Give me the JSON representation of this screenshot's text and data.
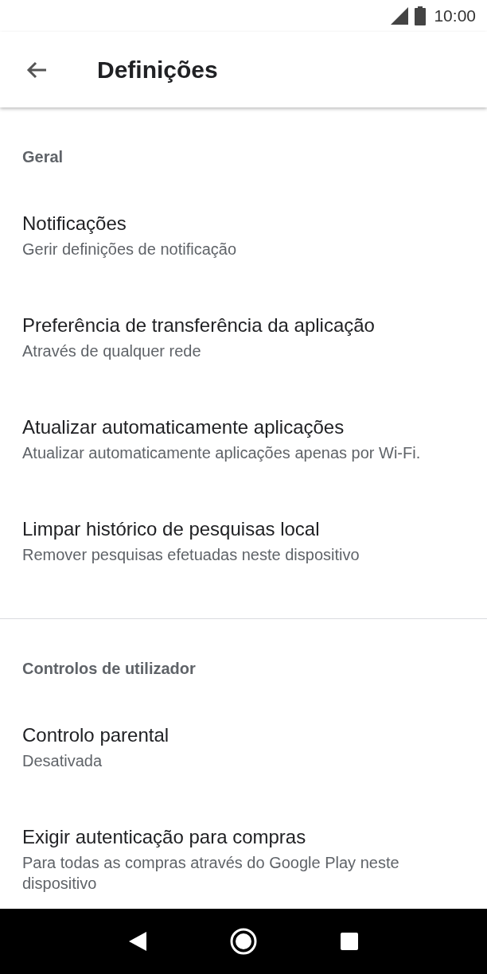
{
  "status_bar": {
    "time": "10:00"
  },
  "app_bar": {
    "title": "Definições"
  },
  "sections": [
    {
      "header": "Geral",
      "items": [
        {
          "title": "Notificações",
          "subtitle": "Gerir definições de notificação"
        },
        {
          "title": "Preferência de transferência da aplicação",
          "subtitle": "Através de qualquer rede"
        },
        {
          "title": "Atualizar automaticamente aplicações",
          "subtitle": "Atualizar automaticamente aplicações apenas por Wi-Fi."
        },
        {
          "title": "Limpar histórico de pesquisas local",
          "subtitle": "Remover pesquisas efetuadas neste dispositivo"
        }
      ]
    },
    {
      "header": "Controlos de utilizador",
      "items": [
        {
          "title": "Controlo parental",
          "subtitle": "Desativada"
        },
        {
          "title": "Exigir autenticação para compras",
          "subtitle": "Para todas as compras através do Google Play neste dispositivo"
        }
      ]
    }
  ]
}
